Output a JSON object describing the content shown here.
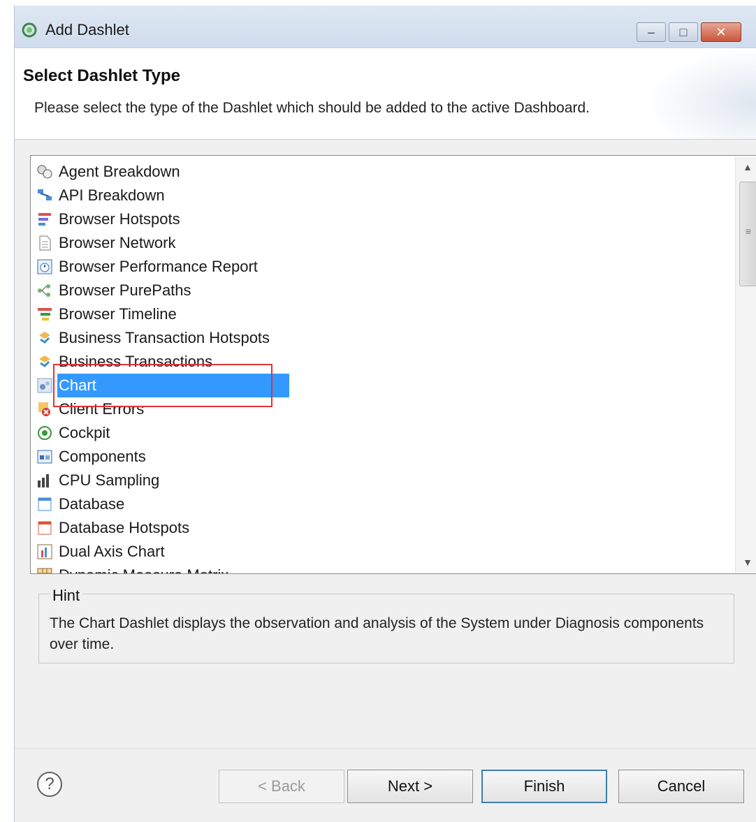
{
  "window": {
    "title": "Add Dashlet"
  },
  "banner": {
    "title": "Select Dashlet Type",
    "description": "Please select the type of the Dashlet which should be added to the active Dashboard."
  },
  "list": {
    "selected": "Chart",
    "items": [
      {
        "label": "Agent Breakdown",
        "icon": "agent-breakdown-icon"
      },
      {
        "label": "API Breakdown",
        "icon": "api-breakdown-icon"
      },
      {
        "label": "Browser Hotspots",
        "icon": "browser-hotspots-icon"
      },
      {
        "label": "Browser Network",
        "icon": "document-icon"
      },
      {
        "label": "Browser Performance Report",
        "icon": "stopwatch-icon"
      },
      {
        "label": "Browser PurePaths",
        "icon": "purepaths-icon"
      },
      {
        "label": "Browser Timeline",
        "icon": "timeline-icon"
      },
      {
        "label": "Business Transaction Hotspots",
        "icon": "business-transaction-icon"
      },
      {
        "label": "Business Transactions",
        "icon": "business-transaction-icon"
      },
      {
        "label": "Chart",
        "icon": "chart-icon"
      },
      {
        "label": "Client Errors",
        "icon": "error-icon"
      },
      {
        "label": "Cockpit",
        "icon": "cockpit-icon"
      },
      {
        "label": "Components",
        "icon": "components-icon"
      },
      {
        "label": "CPU Sampling",
        "icon": "bar-chart-icon"
      },
      {
        "label": "Database",
        "icon": "database-icon"
      },
      {
        "label": "Database Hotspots",
        "icon": "database-hotspots-icon"
      },
      {
        "label": "Dual Axis Chart",
        "icon": "dual-axis-chart-icon"
      },
      {
        "label": "Dynamic Measure Matrix",
        "icon": "matrix-icon"
      }
    ]
  },
  "hint": {
    "legend": "Hint",
    "text": "The Chart Dashlet displays the observation and analysis of the System under Diagnosis components over time."
  },
  "buttons": {
    "back": "< Back",
    "next": "Next >",
    "finish": "Finish",
    "cancel": "Cancel",
    "help": "?"
  },
  "colors": {
    "selection": "#3399ff",
    "highlight_box": "#e0333a",
    "titlebar": "#cfdced"
  }
}
